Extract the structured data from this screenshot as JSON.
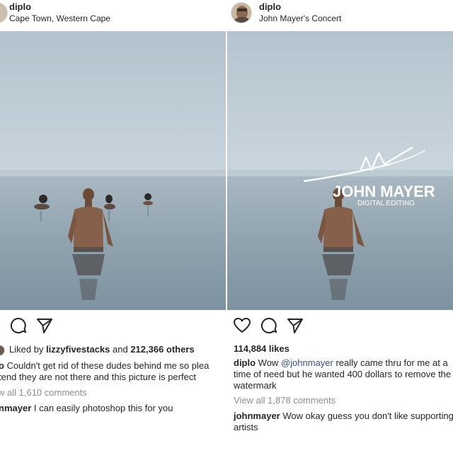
{
  "left_post": {
    "username": "diplo",
    "location": "Cape Town, Western Cape",
    "icons": [
      "comment-icon",
      "share-icon"
    ],
    "likes_prefix": "Liked by ",
    "likes_user": "lizzyfivestacks",
    "likes_middle": " and ",
    "likes_count": "212,366 others",
    "caption_user": "o",
    "caption_line1": " Couldn't get rid of these dudes behind me so plea",
    "caption_line2": "tend they are not there and this picture is perfect",
    "view_all": "w all 1,610 comments",
    "comment_user": "nmayer",
    "comment_text": " I can easily photoshop this for you"
  },
  "right_post": {
    "username": "diplo",
    "location": "John Mayer's Concert",
    "icons": [
      "heart-icon",
      "comment-icon",
      "share-icon"
    ],
    "likes": "114,884 likes",
    "caption_user": "diplo",
    "caption_pre": " Wow ",
    "caption_mention": "@johnmayer",
    "caption_post": " really came thru for me at a time of need but he wanted 400 dollars to remove the watermark",
    "view_all": "View all 1,878 comments",
    "comment_user": "johnmayer",
    "comment_text": " Wow okay guess you don't like supporting artists",
    "watermark_title": "JOHN MAYER",
    "watermark_subtitle": "DIGITAL EDITING"
  },
  "colors": {
    "sky": "#c7d3da",
    "water": "#8ea3b0",
    "text": "#262626",
    "muted": "#8e8e8e",
    "mention": "#385185"
  }
}
